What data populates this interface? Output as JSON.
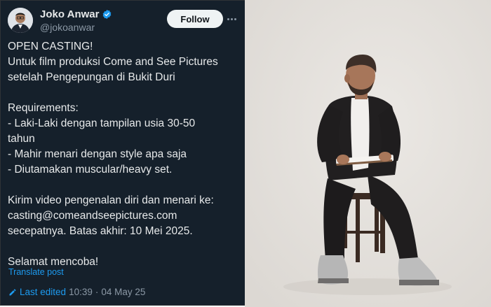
{
  "author": {
    "name": "Joko Anwar",
    "handle": "@jokoanwar",
    "verified": true
  },
  "follow_label": "Follow",
  "post_lines": [
    "OPEN CASTING!",
    "Untuk film produksi Come and See Pictures",
    "setelah Pengepungan di Bukit Duri",
    "",
    "Requirements:",
    "- Laki-Laki dengan tampilan usia 30-50",
    "tahun",
    "- Mahir menari dengan style apa saja",
    "- Diutamakan muscular/heavy set.",
    "",
    "Kirim video pengenalan diri dan menari ke:",
    "casting@comeandseepictures.com",
    "secepatnya. Batas akhir: 10 Mei 2025.",
    "",
    "Selamat mencoba!"
  ],
  "translate_label": "Translate post",
  "edited": {
    "label": "Last edited",
    "time": "10:39",
    "separator": "·",
    "date": "04 May 25"
  },
  "colors": {
    "background": "#15202b",
    "accent": "#1d9bf0",
    "text": "#e7e9ea",
    "muted": "#8b98a5",
    "photo_backdrop": "#e6e3df"
  },
  "icons": {
    "verified": "verified-badge-icon",
    "edit": "pencil-icon",
    "more": "more-options-icon"
  }
}
